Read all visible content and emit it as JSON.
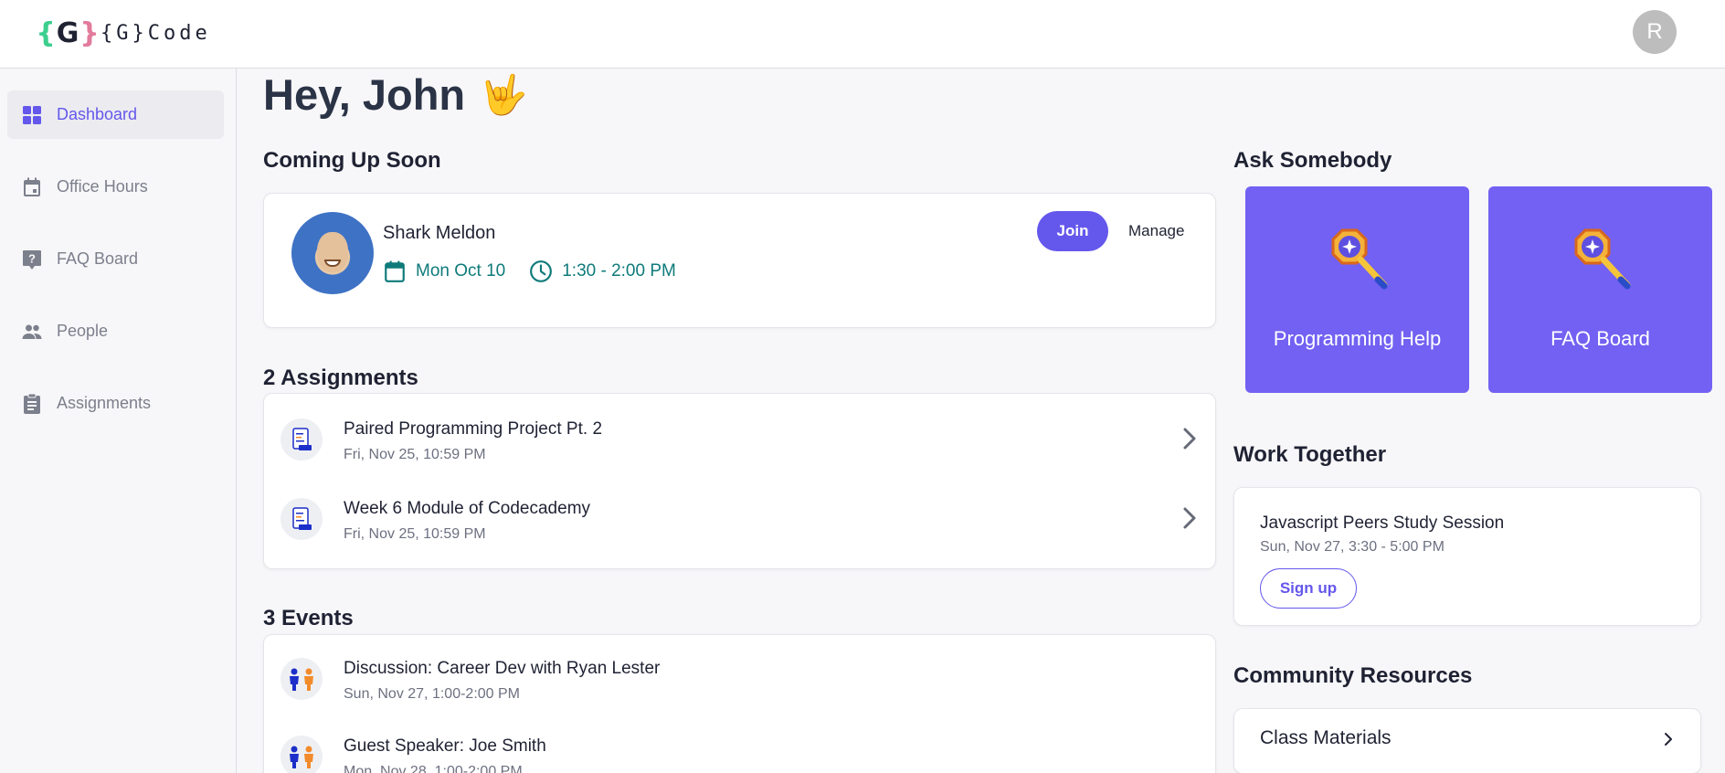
{
  "header": {
    "logo_mark_left": "{",
    "logo_mark_letter": "G",
    "logo_mark_right": "}",
    "logo_text": "{G}Code",
    "avatar_initial": "R"
  },
  "sidebar": {
    "items": [
      {
        "label": "Dashboard",
        "icon": "dashboard-grid-icon",
        "active": true
      },
      {
        "label": "Office Hours",
        "icon": "calendar-icon",
        "active": false
      },
      {
        "label": "FAQ Board",
        "icon": "help-bubble-icon",
        "active": false
      },
      {
        "label": "People",
        "icon": "people-icon",
        "active": false
      },
      {
        "label": "Assignments",
        "icon": "clipboard-icon",
        "active": false
      }
    ]
  },
  "main": {
    "greeting": "Hey, John",
    "greeting_emoji": "🤟",
    "coming_up": {
      "title": "Coming Up Soon",
      "person": "Shark Meldon",
      "date": "Mon Oct 10",
      "time": "1:30 - 2:00 PM",
      "join_label": "Join",
      "manage_label": "Manage"
    },
    "assignments": {
      "title": "2 Assignments",
      "items": [
        {
          "title": "Paired Programming Project Pt. 2",
          "due": "Fri, Nov 25, 10:59 PM"
        },
        {
          "title": "Week 6 Module of Codecademy",
          "due": "Fri, Nov 25, 10:59 PM"
        }
      ]
    },
    "events": {
      "title": "3 Events",
      "items": [
        {
          "title": "Discussion: Career Dev with Ryan Lester",
          "when": "Sun, Nov 27, 1:00-2:00 PM"
        },
        {
          "title": "Guest Speaker: Joe Smith",
          "when": "Mon, Nov 28, 1:00-2:00 PM"
        }
      ]
    }
  },
  "right": {
    "ask": {
      "title": "Ask Somebody",
      "tiles": [
        {
          "label": "Programming Help",
          "icon": "magnifier-sparkle-icon"
        },
        {
          "label": "FAQ Board",
          "icon": "magnifier-sparkle-icon"
        }
      ]
    },
    "work_together": {
      "title": "Work Together",
      "session_title": "Javascript Peers Study Session",
      "session_time": "Sun, Nov 27, 3:30 - 5:00 PM",
      "signup_label": "Sign up"
    },
    "community": {
      "title": "Community Resources",
      "items": [
        {
          "label": "Class Materials"
        }
      ]
    }
  },
  "colors": {
    "accent": "#6457ec",
    "tile": "#7261f2",
    "teal": "#0f7a7a"
  }
}
